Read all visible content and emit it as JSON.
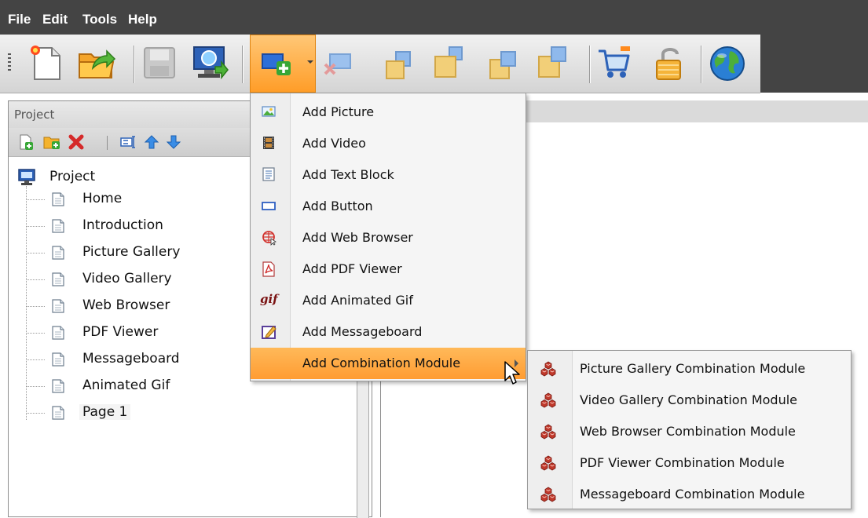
{
  "menubar": {
    "items": [
      "File",
      "Edit",
      "Tools",
      "Help"
    ]
  },
  "toolbar": {
    "icons": [
      "new-page-icon",
      "open-folder-icon",
      "save-disk-icon",
      "preview-monitor-icon",
      "add-element-icon",
      "remove-element-icon",
      "bring-forward-icon",
      "bring-to-front-icon",
      "send-backward-icon",
      "send-to-back-icon",
      "shopping-cart-icon",
      "padlock-open-icon",
      "globe-icon"
    ]
  },
  "project_panel": {
    "title": "Project",
    "tree": {
      "root_label": "Project",
      "pages": [
        "Home",
        "Introduction",
        "Picture Gallery",
        "Video Gallery",
        "Web Browser",
        "PDF Viewer",
        "Messageboard",
        "Animated Gif",
        "Page 1"
      ],
      "selected": "Page 1"
    }
  },
  "add_menu": {
    "items": [
      {
        "label": "Add Picture",
        "icon": "picture-icon"
      },
      {
        "label": "Add Video",
        "icon": "film-icon"
      },
      {
        "label": "Add Text Block",
        "icon": "text-block-icon"
      },
      {
        "label": "Add Button",
        "icon": "button-icon"
      },
      {
        "label": "Add Web Browser",
        "icon": "web-browser-icon"
      },
      {
        "label": "Add PDF Viewer",
        "icon": "pdf-icon"
      },
      {
        "label": "Add Animated Gif",
        "icon": "gif-icon",
        "icon_text": "gif"
      },
      {
        "label": "Add Messageboard",
        "icon": "messageboard-icon"
      },
      {
        "label": "Add Combination Module",
        "icon": "",
        "highlighted": true,
        "has_submenu": true
      }
    ]
  },
  "combination_submenu": {
    "items": [
      {
        "label": "Picture Gallery Combination Module",
        "icon": "combination-module-icon"
      },
      {
        "label": "Video Gallery Combination Module",
        "icon": "combination-module-icon"
      },
      {
        "label": "Web Browser Combination Module",
        "icon": "combination-module-icon"
      },
      {
        "label": "PDF Viewer Combination Module",
        "icon": "combination-module-icon"
      },
      {
        "label": "Messageboard Combination Module",
        "icon": "combination-module-icon"
      }
    ]
  },
  "colors": {
    "menubar_bg": "#444444",
    "highlight": "#ff9c32",
    "accent_blue": "#2a6fd6",
    "delete_red": "#d02020"
  }
}
